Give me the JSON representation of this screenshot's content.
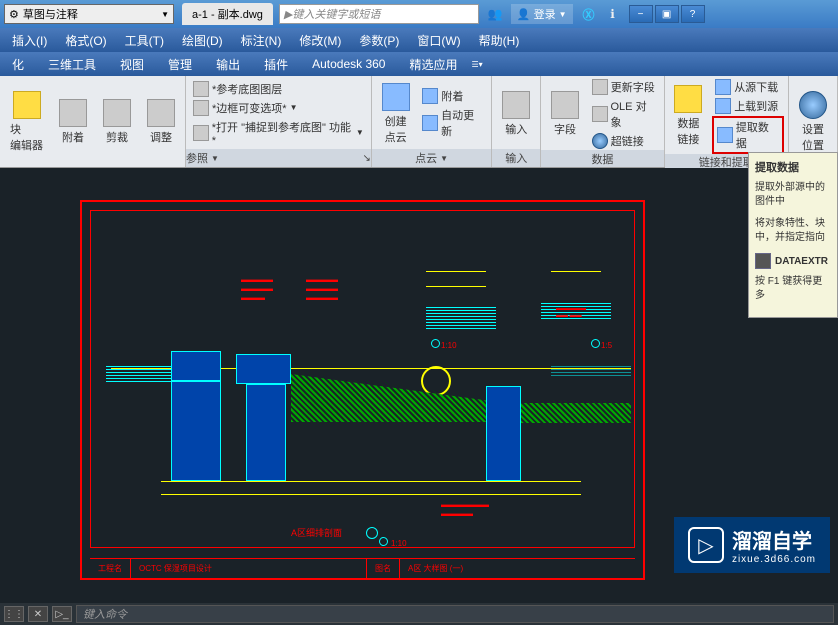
{
  "titlebar": {
    "workspace": "草图与注释",
    "filename": "a-1 - 副本.dwg",
    "search_placeholder": "键入关键字或短语",
    "login": "登录"
  },
  "menubar": {
    "items": [
      "插入(I)",
      "格式(O)",
      "工具(T)",
      "绘图(D)",
      "标注(N)",
      "修改(M)",
      "参数(P)",
      "窗口(W)",
      "帮助(H)"
    ]
  },
  "tabbar": {
    "items": [
      "化",
      "三维工具",
      "视图",
      "管理",
      "输出",
      "插件",
      "Autodesk 360",
      "精选应用"
    ]
  },
  "ribbon": {
    "panel1": {
      "title": "",
      "block_editor": "块\n编辑器",
      "attach": "附着",
      "clip": "剪裁",
      "adjust": "调整"
    },
    "panel2": {
      "title": "参照",
      "ref_layer": "*参考底图图层",
      "border_opt": "*边框可变选项*",
      "snap_func": "*打开 \"捕捉到参考底图\" 功能*"
    },
    "panel3": {
      "title": "点云",
      "create_cloud": "创建\n点云",
      "attach": "附着",
      "auto_update": "自动更新"
    },
    "panel4": {
      "title": "输入",
      "input": "输入"
    },
    "panel5": {
      "title": "数据",
      "field": "字段",
      "update_field": "更新字段",
      "ole_object": "OLE 对象",
      "hyperlink": "超链接"
    },
    "panel6": {
      "title": "链接和提取",
      "data_link": "数据\n链接",
      "download": "从源下载",
      "upload": "上载到源",
      "extract_data": "提取数据"
    },
    "panel7": {
      "title": "",
      "set_loc": "设置\n位置"
    }
  },
  "tooltip": {
    "title": "提取数据",
    "text1": "提取外部源中的图件中",
    "text2": "将对象特性、块中，并指定指向",
    "cmd": "DATAEXTR",
    "help": "按 F1 键获得更多"
  },
  "drawing": {
    "scale1": "1:10",
    "scale2": "1:5",
    "scale3": "1:10",
    "title_label": "A区细排剖面",
    "footer1": "工程名",
    "footer2": "OCTC 保湿项目设计",
    "footer3": "图名",
    "footer4": "A区 大样图 (一)"
  },
  "watermark": {
    "text": "溜溜自学",
    "url": "zixue.3d66.com"
  },
  "cmdbar": {
    "placeholder": "键入命令"
  }
}
